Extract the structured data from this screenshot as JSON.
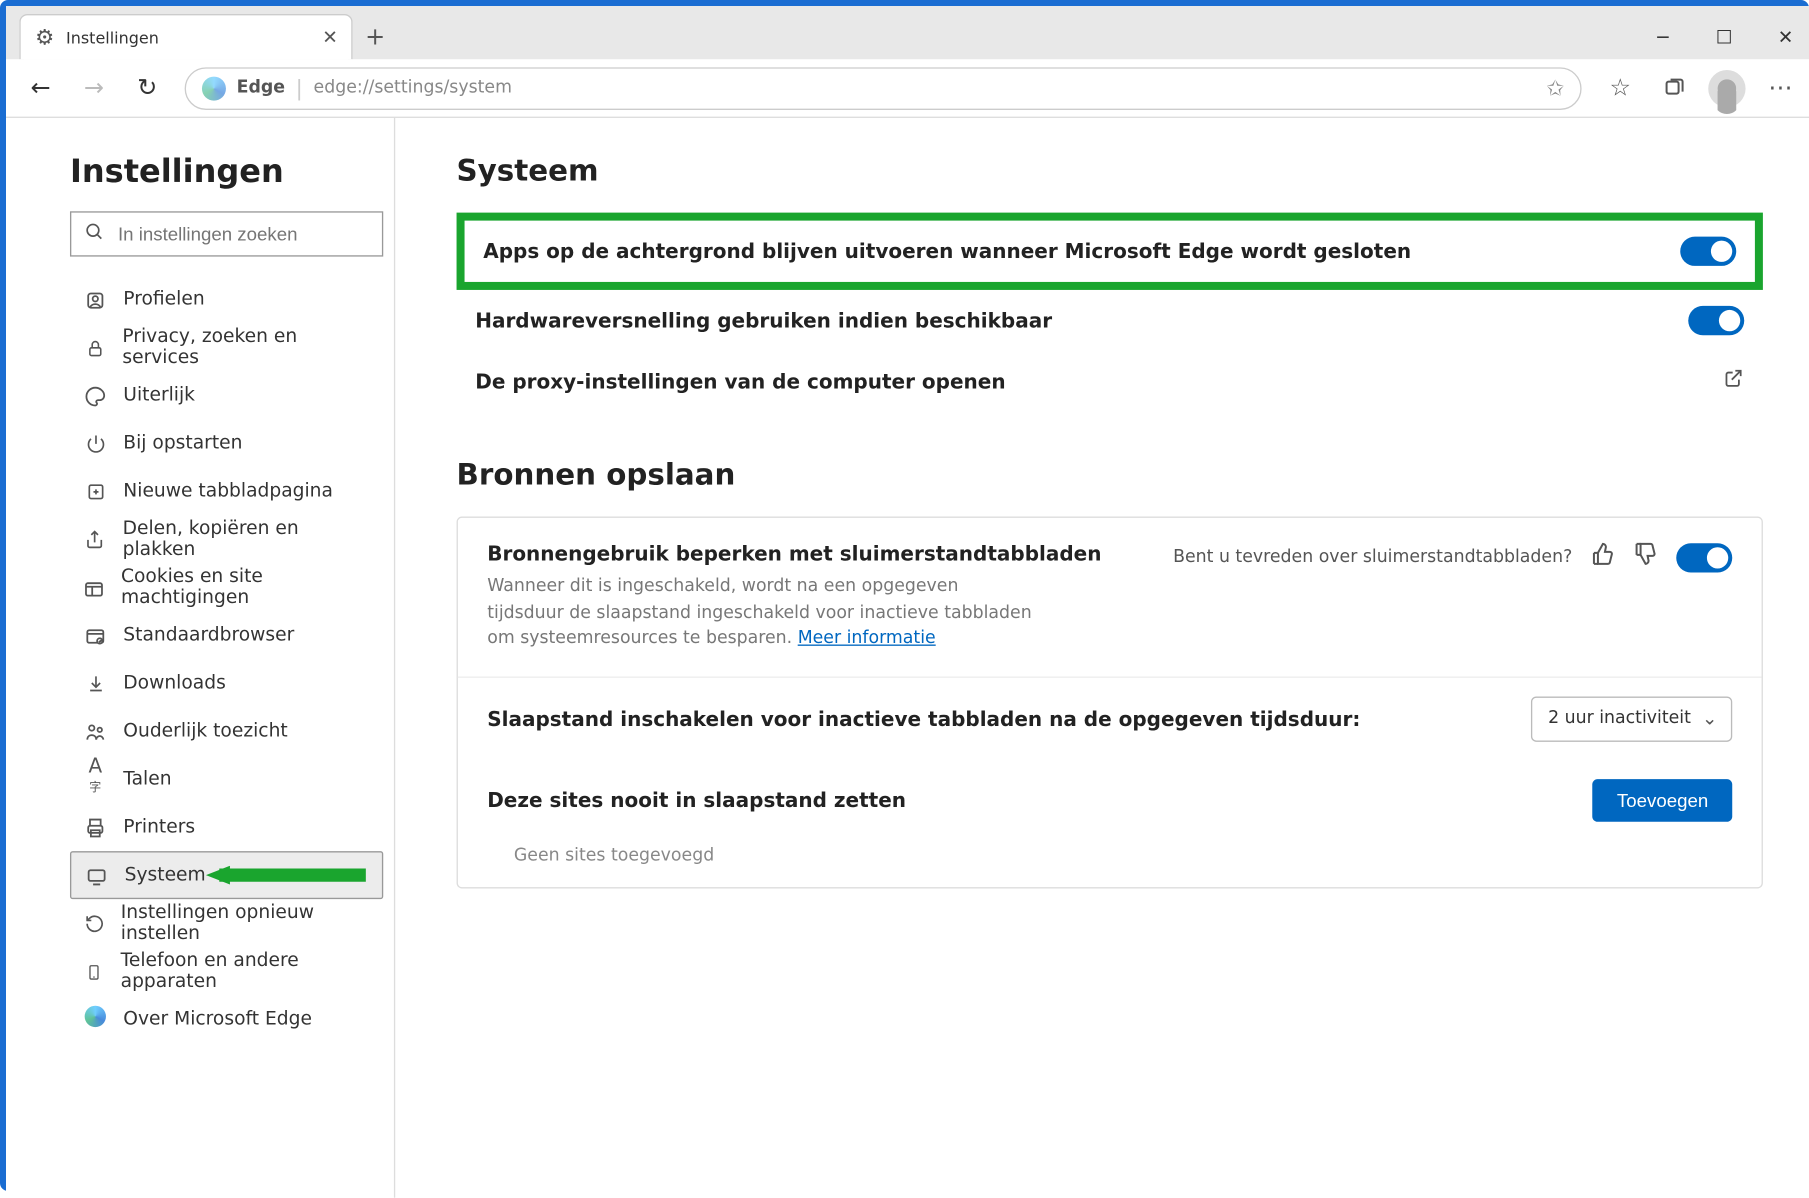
{
  "window": {
    "tab_title": "Instellingen"
  },
  "toolbar": {
    "addr_label": "Edge",
    "addr_url": "edge://settings/system"
  },
  "sidebar": {
    "page_title": "Instellingen",
    "search_placeholder": "In instellingen zoeken",
    "items": [
      {
        "label": "Profielen"
      },
      {
        "label": "Privacy, zoeken en services"
      },
      {
        "label": "Uiterlijk"
      },
      {
        "label": "Bij opstarten"
      },
      {
        "label": "Nieuwe tabbladpagina"
      },
      {
        "label": "Delen, kopiëren en plakken"
      },
      {
        "label": "Cookies en site machtigingen"
      },
      {
        "label": "Standaardbrowser"
      },
      {
        "label": "Downloads"
      },
      {
        "label": "Ouderlijk toezicht"
      },
      {
        "label": "Talen"
      },
      {
        "label": "Printers"
      },
      {
        "label": "Systeem"
      },
      {
        "label": "Instellingen opnieuw instellen"
      },
      {
        "label": "Telefoon en andere apparaten"
      },
      {
        "label": "Over Microsoft Edge"
      }
    ]
  },
  "main": {
    "heading": "Systeem",
    "rows": {
      "background_apps": "Apps op de achtergrond blijven uitvoeren wanneer Microsoft Edge wordt gesloten",
      "hw_accel": "Hardwareversnelling gebruiken indien beschikbaar",
      "proxy": "De proxy-instellingen van de computer openen"
    },
    "save_heading": "Bronnen opslaan",
    "card": {
      "title": "Bronnengebruik beperken met sluimerstandtabbladen",
      "desc_prefix": "Wanneer dit is ingeschakeld, wordt na een opgegeven tijdsduur de slaapstand ingeschakeld voor inactieve tabbladen om systeemresources te besparen. ",
      "desc_link": "Meer informatie",
      "feedback_q": "Bent u tevreden over sluimerstandtabbladen?",
      "sleep_after_label": "Slaapstand inschakelen voor inactieve tabbladen na de opgegeven tijdsduur:",
      "sleep_after_value": "2 uur inactiviteit",
      "never_sleep_label": "Deze sites nooit in slaapstand zetten",
      "add_button": "Toevoegen",
      "no_sites": "Geen sites toegevoegd"
    }
  }
}
